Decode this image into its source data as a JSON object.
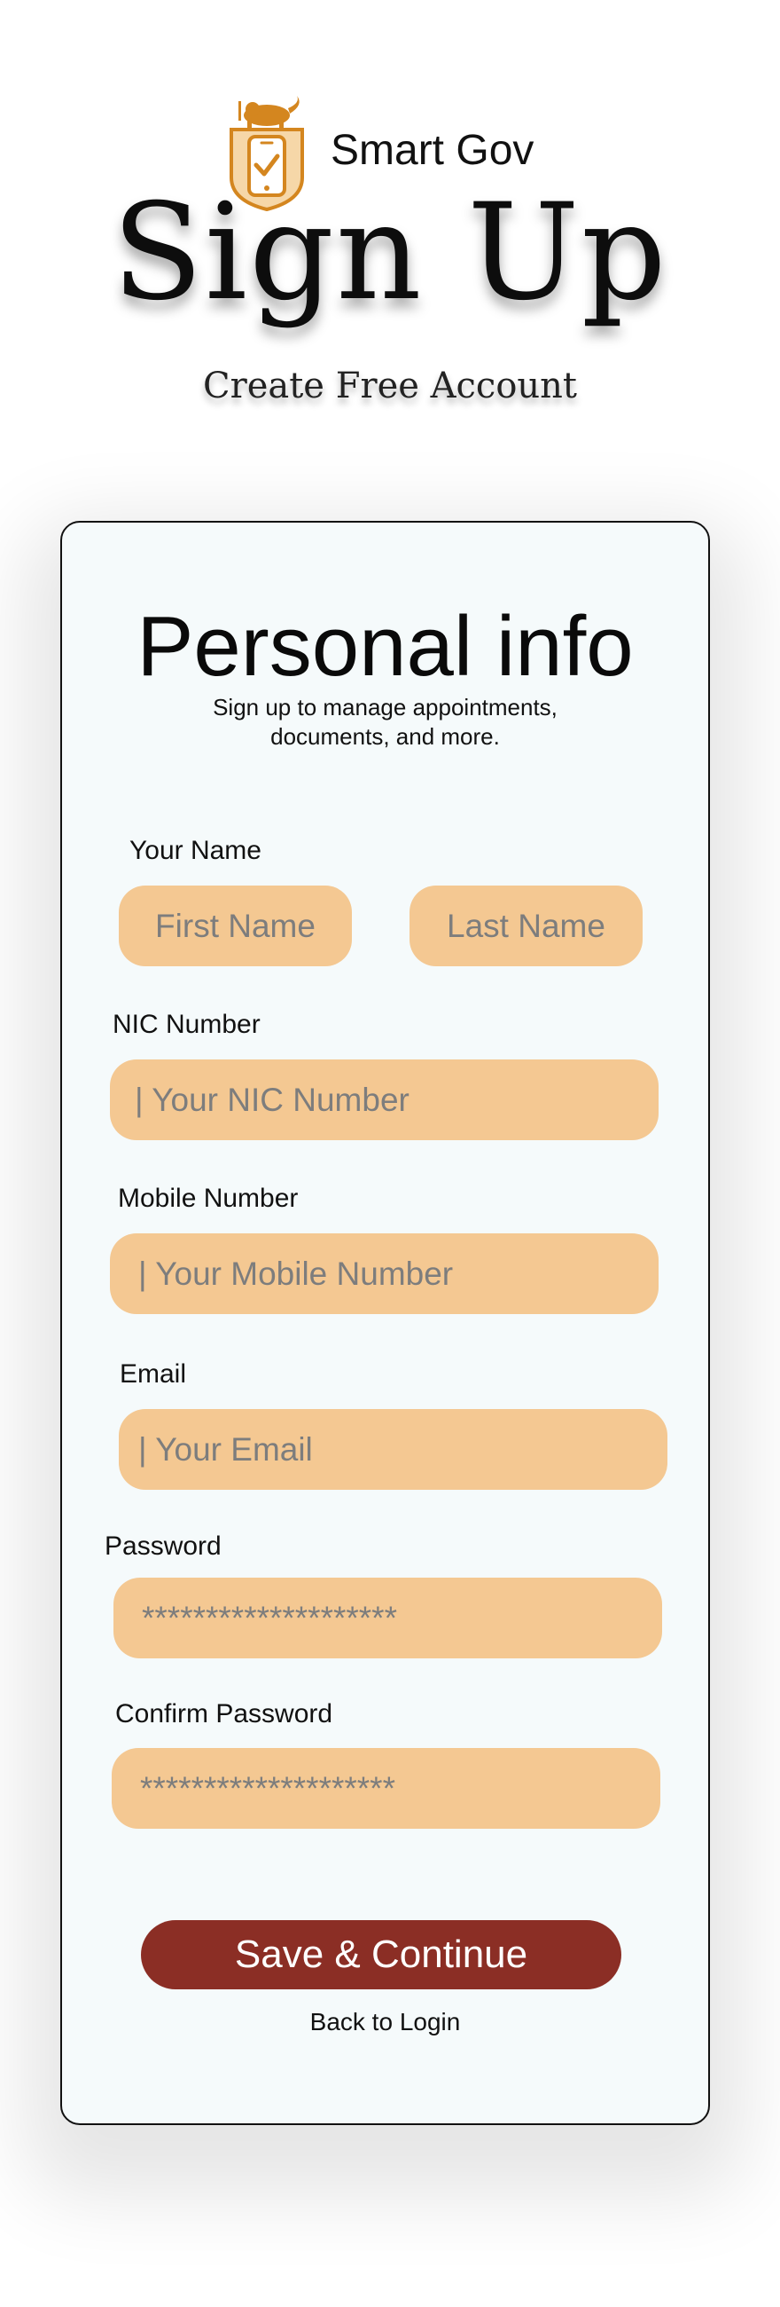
{
  "brand": {
    "name": "Smart Gov",
    "logo_icon": "lion-shield-phone-check-icon",
    "logo_color": "#d4861f"
  },
  "hero": {
    "title": "Sign Up",
    "subtitle": "Create Free Account"
  },
  "form": {
    "title": "Personal info",
    "subtitle_line1": "Sign up to manage appointments,",
    "subtitle_line2": "documents, and more.",
    "name_label": "Your Name",
    "first_name_placeholder": "First Name",
    "last_name_placeholder": "Last Name",
    "nic_label": "NIC Number",
    "nic_placeholder": "| Your NIC Number",
    "mobile_label": "Mobile Number",
    "mobile_placeholder": "| Your Mobile Number",
    "email_label": "Email",
    "email_placeholder": "| Your Email",
    "password_label": "Password",
    "password_placeholder": "********************",
    "confirm_password_label": "Confirm Password",
    "confirm_password_placeholder": "********************",
    "save_button_label": "Save & Continue",
    "back_link_label": "Back to Login"
  },
  "colors": {
    "input_fill": "#f4c892",
    "button_fill": "#8b2e25",
    "card_background": "#f5fafb"
  }
}
